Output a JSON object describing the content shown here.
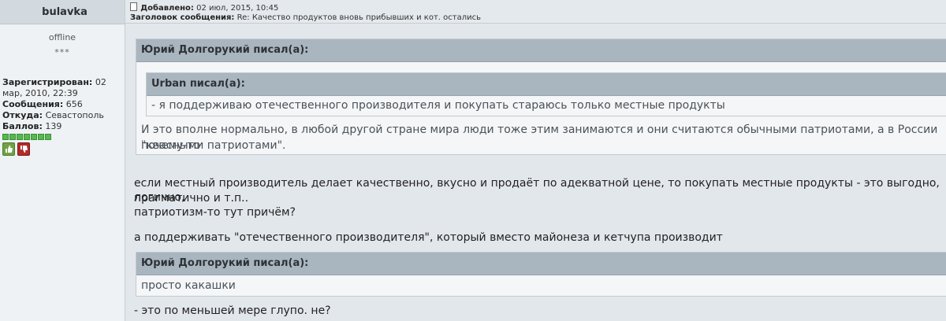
{
  "author": {
    "name": "bulavka",
    "status": "offline",
    "rank": "***",
    "registered_label": "Зарегистрирован:",
    "registered_value": "02 мар, 2010, 22:39",
    "messages_label": "Сообщения:",
    "messages_value": "656",
    "location_label": "Откуда:",
    "location_value": "Севастополь",
    "points_label": "Баллов:",
    "points_value": "139"
  },
  "post": {
    "added_label": "Добавлено:",
    "added_value": "02 июл, 2015, 10:45",
    "subject_label": "Заголовок сообщения:",
    "subject_value": "Re: Качество продуктов вновь прибывших и кот. остались"
  },
  "quote1": {
    "author": "Юрий Долгорукий писал(а):",
    "nested_author": "Urban писал(а):",
    "nested_text": "- я поддерживаю отечественного производителя и покупать стараюсь только местные продукты",
    "text_line1": "И это вполне нормально, в любой другой стране мира люди тоже этим занимаются и они считаются обычными патриотами, а в России почему-то",
    "text_line2": "\"квасными патриотами\"."
  },
  "body": {
    "line1": "если местный производитель делает качественно, вкусно и продаёт по адекватной цене, то покупать местные продукты - это выгодно, логично,",
    "line2": "прагматично и т.п..",
    "line3": "патриотизм-то тут причём?",
    "line4": "а поддерживать \"отечественного производителя\", который вместо майонеза и кетчупа производит"
  },
  "quote2": {
    "author": "Юрий Долгорукий писал(а):",
    "text": "просто какашки"
  },
  "closing": "- это по меньшей мере глупо. не?"
}
